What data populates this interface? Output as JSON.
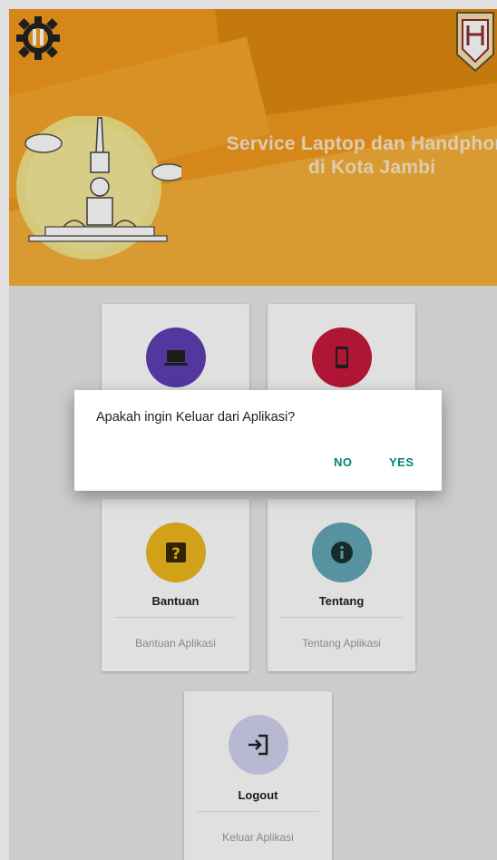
{
  "header": {
    "title": "Service Laptop dan Handphone\ndi Kota Jambi"
  },
  "menu": {
    "laptop": {
      "icon": "laptop-icon",
      "color": "#5f3fb4"
    },
    "handphone": {
      "icon": "smartphone-icon",
      "color": "#c8183c"
    },
    "bantuan": {
      "title": "Bantuan",
      "subtitle": "Bantuan Aplikasi",
      "icon": "help-icon",
      "color": "#f0b81e"
    },
    "tentang": {
      "title": "Tentang",
      "subtitle": "Tentang Aplikasi",
      "icon": "info-icon",
      "color": "#62a7b6"
    },
    "logout": {
      "title": "Logout",
      "subtitle": "Keluar Aplikasi",
      "icon": "logout-icon",
      "color": "#d3d2f0"
    }
  },
  "dialog": {
    "message": "Apakah ingin Keluar dari Aplikasi?",
    "no_label": "NO",
    "yes_label": "YES"
  }
}
